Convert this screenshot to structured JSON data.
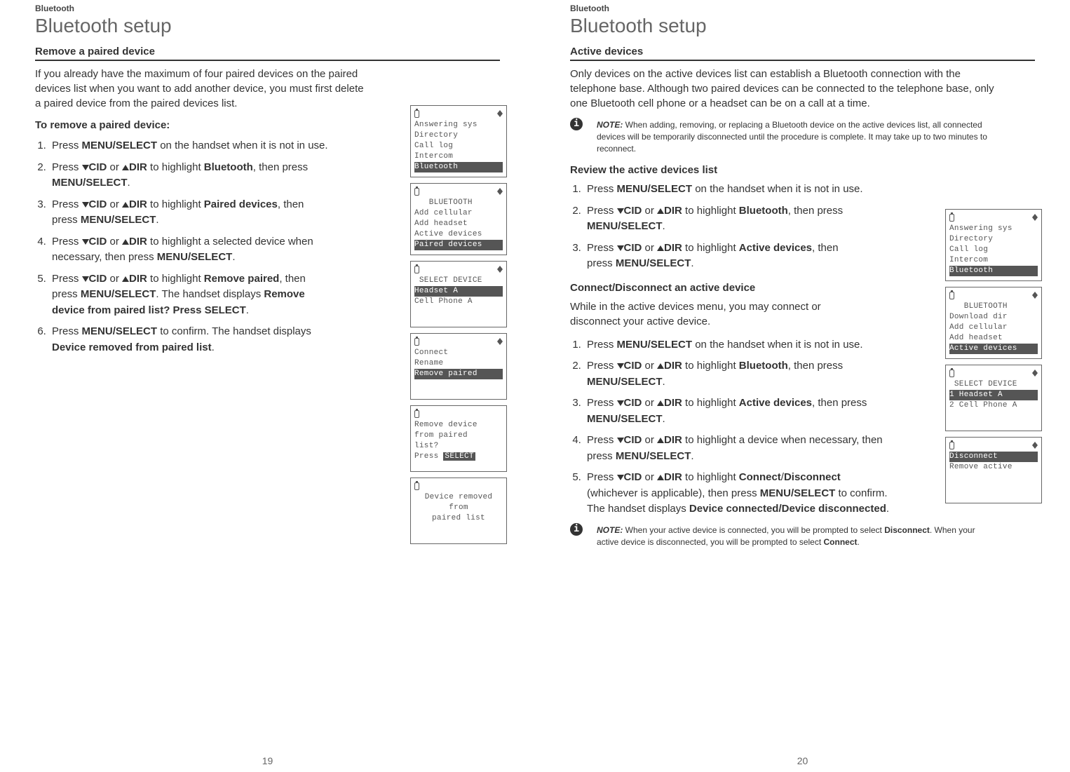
{
  "left": {
    "section_label": "Bluetooth",
    "title": "Bluetooth setup",
    "subsection": "Remove a paired device",
    "intro": "If you already have the maximum of four paired devices on the paired devices list when you want to add another device, you must first delete a paired device from the paired devices list.",
    "procedure_title": "To remove a paired device:",
    "steps": {
      "s1a": "Press ",
      "s1b": "MENU/",
      "s1c": "SELECT",
      "s1d": " on the handset when it is not in use.",
      "s2a": "Press ",
      "s2b": "CID",
      "s2c": " or ",
      "s2d": "DIR",
      "s2e": " to highlight ",
      "s2f": "Bluetooth",
      "s2g": ", then press ",
      "s2h": "MENU",
      "s2i": "/SELECT",
      "s2j": ".",
      "s3a": "Press ",
      "s3b": "CID",
      "s3c": " or ",
      "s3d": "DIR",
      "s3e": " to highlight ",
      "s3f": "Paired devices",
      "s3g": ", then press ",
      "s3h": "MENU",
      "s3i": "/SELECT",
      "s3j": ".",
      "s4a": "Press ",
      "s4b": "CID",
      "s4c": " or ",
      "s4d": "DIR",
      "s4e": " to highlight a selected device when necessary, then press ",
      "s4f": "MENU",
      "s4g": "/SELECT",
      "s4h": ".",
      "s5a": "Press ",
      "s5b": "CID",
      "s5c": " or ",
      "s5d": "DIR",
      "s5e": " to highlight ",
      "s5f": "Remove paired",
      "s5g": ", then press ",
      "s5h": "MENU",
      "s5i": "/SELECT",
      "s5j": ". The handset displays ",
      "s5k": "Remove device from paired list? Press SELECT",
      "s5l": ".",
      "s6a": "Press ",
      "s6b": "MENU",
      "s6c": "/SELECT",
      "s6d": " to confirm. The handset displays ",
      "s6e": "Device removed from paired list",
      "s6f": "."
    },
    "screens": {
      "a": {
        "l1": "Answering sys",
        "l2": "Directory",
        "l3": "Call log",
        "l4": "Intercom",
        "l5": "Bluetooth"
      },
      "b": {
        "l1": "   BLUETOOTH",
        "l2": "Add cellular",
        "l3": "Add headset",
        "l4": "Active devices",
        "l5": "Paired devices"
      },
      "c": {
        "l1": " SELECT DEVICE",
        "l2": "Headset A",
        "l3": "Cell Phone A"
      },
      "d": {
        "l1": "Connect",
        "l2": "Rename",
        "l3": "Remove paired"
      },
      "e": {
        "l1": "Remove device",
        "l2": "from paired",
        "l3": "list?",
        "l4": "",
        "l5a": "Press ",
        "l5b": "SELECT"
      },
      "f": {
        "l1": "Device removed",
        "l2": "from",
        "l3": "paired list"
      }
    },
    "page_num": "19"
  },
  "right": {
    "section_label": "Bluetooth",
    "title": "Bluetooth setup",
    "subsection": "Active devices",
    "intro": "Only devices on the active devices list can establish a Bluetooth connection with the telephone base. Although two paired devices can be connected to the telephone base, only one Bluetooth cell phone or a headset can be on a call at a time.",
    "note1_label": "NOTE:",
    "note1_text": " When adding, removing, or replacing a Bluetooth device on the active devices list, all connected devices will be temporarily disconnected until the procedure is complete. It may take up to two minutes to reconnect.",
    "review_title": "Review the active devices list",
    "review_steps": {
      "s1a": "Press ",
      "s1b": "MENU/",
      "s1c": "SELECT",
      "s1d": " on the handset when it is not in use.",
      "s2a": "Press ",
      "s2b": "CID",
      "s2c": " or ",
      "s2d": "DIR",
      "s2e": " to highlight ",
      "s2f": "Bluetooth",
      "s2g": ", then press ",
      "s2h": "MENU",
      "s2i": "/SELECT",
      "s2j": ".",
      "s3a": "Press ",
      "s3b": "CID",
      "s3c": " or ",
      "s3d": "DIR",
      "s3e": " to highlight ",
      "s3f": "Active devices",
      "s3g": ", then press ",
      "s3h": "MENU",
      "s3i": "/SELECT",
      "s3j": "."
    },
    "connect_title": "Connect/Disconnect an active device",
    "connect_intro": "While in the active devices menu, you may connect or disconnect your active device.",
    "connect_steps": {
      "s1a": "Press ",
      "s1b": "MENU/",
      "s1c": "SELECT",
      "s1d": " on the handset when it is not in use.",
      "s2a": "Press ",
      "s2b": "CID",
      "s2c": " or ",
      "s2d": "DIR",
      "s2e": " to highlight ",
      "s2f": "Bluetooth",
      "s2g": ", then press ",
      "s2h": "MENU",
      "s2i": "/SELECT",
      "s2j": ".",
      "s3a": "Press ",
      "s3b": "CID",
      "s3c": " or ",
      "s3d": "DIR",
      "s3e": " to highlight ",
      "s3f": "Active devices",
      "s3g": ", then press ",
      "s3h": "MENU",
      "s3i": "/SELECT",
      "s3j": ".",
      "s4a": "Press ",
      "s4b": "CID",
      "s4c": " or ",
      "s4d": "DIR",
      "s4e": " to highlight a device when necessary, then press ",
      "s4f": "MENU",
      "s4g": "/SELECT",
      "s4h": ".",
      "s5a": "Press ",
      "s5b": "CID",
      "s5c": " or ",
      "s5d": "DIR",
      "s5e": " to highlight ",
      "s5f": "Connect",
      "s5g": "/",
      "s5h": "Disconnect",
      "s5i": " (whichever is applicable), then press ",
      "s5j": "MENU",
      "s5k": "/SELECT",
      "s5l": " to confirm. The handset displays ",
      "s5m": "Device connected/Device disconnected",
      "s5n": "."
    },
    "note2_label": "NOTE:",
    "note2a": " When your active device is connected, you will be prompted to select ",
    "note2b": "Disconnect",
    "note2c": ". When your active device is disconnected, you will be prompted to select ",
    "note2d": "Connect",
    "note2e": ".",
    "screens": {
      "a": {
        "l1": "Answering sys",
        "l2": "Directory",
        "l3": "Call log",
        "l4": "Intercom",
        "l5": "Bluetooth"
      },
      "b": {
        "l1": "   BLUETOOTH",
        "l2": "Download dir",
        "l3": "Add cellular",
        "l4": "Add headset",
        "l5": "Active devices"
      },
      "c": {
        "l1": " SELECT DEVICE",
        "l2": "1 Headset A",
        "l3": "2 Cell Phone A"
      },
      "d": {
        "l1": "Disconnect",
        "l2": "Remove active"
      }
    },
    "page_num": "20"
  }
}
